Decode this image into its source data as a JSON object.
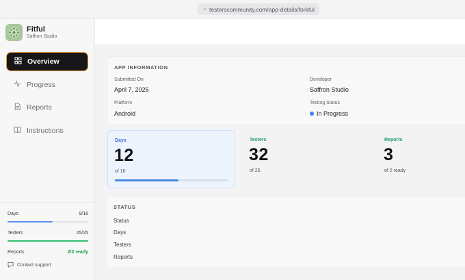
{
  "browser": {
    "url": "testerscommunity.com/app-details/forkful"
  },
  "sidebar": {
    "app_name": "Fitful",
    "studio": "Saffron Studio",
    "nav": [
      {
        "label": "Overview",
        "icon": "grid-icon",
        "active": true
      },
      {
        "label": "Progress",
        "icon": "activity-icon",
        "active": false
      },
      {
        "label": "Reports",
        "icon": "document-icon",
        "active": false
      },
      {
        "label": "Instructions",
        "icon": "book-icon",
        "active": false
      }
    ],
    "stats": {
      "days": {
        "label": "Days",
        "value": "9/16",
        "fraction": 0.5625,
        "color": "#5b8def"
      },
      "testers": {
        "label": "Testers",
        "value": "25/25",
        "fraction": 1.0,
        "color": "#2fbf71"
      },
      "reports": {
        "label": "Reports",
        "value": "2/2 ready"
      }
    },
    "support_label": "Contact support"
  },
  "app_info": {
    "title": "APP INFORMATION",
    "submitted_label": "Submitted On",
    "submitted_value": "April 7, 2026",
    "developer_label": "Developer",
    "developer_value": "Saffron Studio",
    "platform_label": "Platform",
    "platform_value": "Android",
    "status_label": "Testing Status",
    "status_value": "In Progress",
    "status_color": "#3b82f6"
  },
  "metrics": {
    "days": {
      "label": "Days",
      "value": "12",
      "sub": "of 16",
      "progress": 0.56,
      "color": "#3b6fd6"
    },
    "testers": {
      "label": "Testers",
      "value": "32",
      "sub": "of 25",
      "color": "#1f9d68"
    },
    "reports": {
      "label": "Reports",
      "value": "3",
      "sub": "of 2 ready",
      "color": "#1f9d68"
    }
  },
  "status": {
    "title": "STATUS",
    "items": [
      "Status",
      "Days",
      "Testers",
      "Reports"
    ]
  }
}
